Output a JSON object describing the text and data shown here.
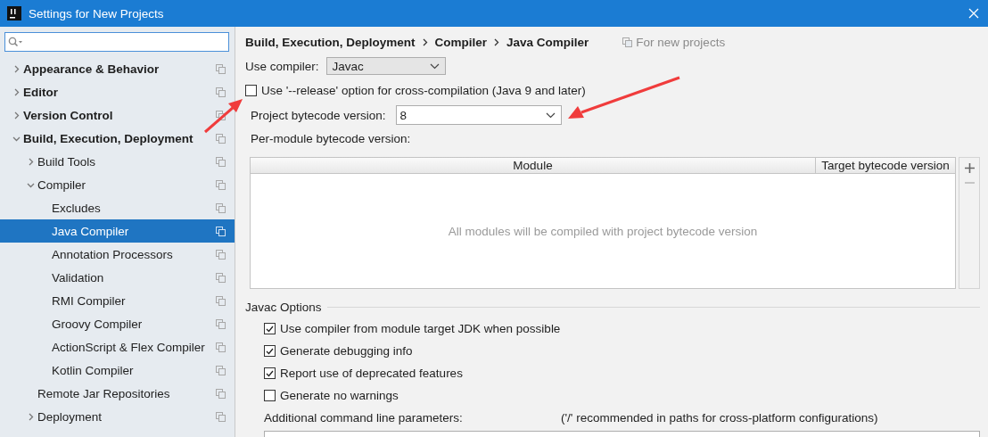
{
  "window": {
    "title": "Settings for New Projects"
  },
  "sidebar": {
    "items": [
      {
        "label": "Appearance & Behavior",
        "expanded": false,
        "selected": false
      },
      {
        "label": "Editor",
        "expanded": false,
        "selected": false
      },
      {
        "label": "Version Control",
        "expanded": false,
        "selected": false
      },
      {
        "label": "Build, Execution, Deployment",
        "expanded": true,
        "selected": false,
        "children": [
          {
            "label": "Build Tools",
            "expanded": false,
            "selected": false
          },
          {
            "label": "Compiler",
            "expanded": true,
            "selected": false,
            "children": [
              {
                "label": "Excludes",
                "selected": false
              },
              {
                "label": "Java Compiler",
                "selected": true
              },
              {
                "label": "Annotation Processors",
                "selected": false
              },
              {
                "label": "Validation",
                "selected": false
              },
              {
                "label": "RMI Compiler",
                "selected": false
              },
              {
                "label": "Groovy Compiler",
                "selected": false
              },
              {
                "label": "ActionScript & Flex Compiler",
                "selected": false
              },
              {
                "label": "Kotlin Compiler",
                "selected": false
              }
            ]
          },
          {
            "label": "Remote Jar Repositories",
            "selected": false
          },
          {
            "label": "Deployment",
            "expanded": false,
            "selected": false
          }
        ]
      }
    ]
  },
  "breadcrumb": [
    "Build, Execution, Deployment",
    "Compiler",
    "Java Compiler"
  ],
  "scope_note": "For new projects",
  "use_compiler": {
    "label": "Use compiler:",
    "value": "Javac"
  },
  "release_option": {
    "label": "Use '--release' option for cross-compilation (Java 9 and later)",
    "checked": false
  },
  "bytecode_version": {
    "label": "Project bytecode version:",
    "value": "8"
  },
  "per_module": {
    "label": "Per-module bytecode version:",
    "table": {
      "columns": [
        "Module",
        "Target bytecode version"
      ],
      "empty_text": "All modules will be compiled with project bytecode version"
    }
  },
  "javac_options": {
    "title": "Javac Options",
    "options": [
      {
        "label": "Use compiler from module target JDK when possible",
        "checked": true
      },
      {
        "label": "Generate debugging info",
        "checked": true
      },
      {
        "label": "Report use of deprecated features",
        "checked": true
      },
      {
        "label": "Generate no warnings",
        "checked": false
      }
    ],
    "additional_params": {
      "label": "Additional command line parameters:",
      "hint": "('/' recommended in paths for cross-platform configurations)"
    }
  }
}
